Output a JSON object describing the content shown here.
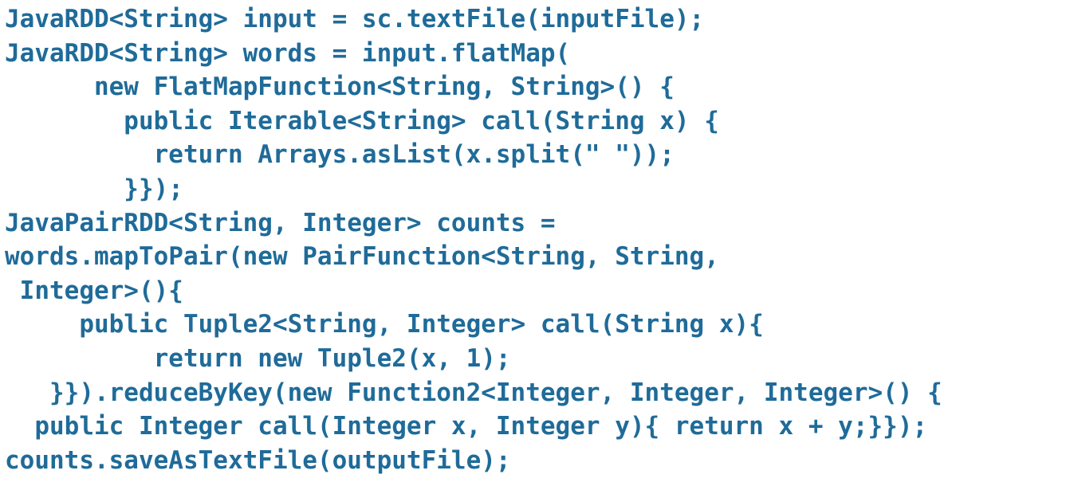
{
  "code": {
    "lines": [
      "JavaRDD<String> input = sc.textFile(inputFile);",
      "JavaRDD<String> words = input.flatMap(",
      "      new FlatMapFunction<String, String>() {",
      "        public Iterable<String> call(String x) {",
      "          return Arrays.asList(x.split(\" \"));",
      "        }});",
      "JavaPairRDD<String, Integer> counts =",
      "words.mapToPair(new PairFunction<String, String,",
      " Integer>(){",
      "     public Tuple2<String, Integer> call(String x){",
      "          return new Tuple2(x, 1);",
      "   }}).reduceByKey(new Function2<Integer, Integer, Integer>() {",
      "  public Integer call(Integer x, Integer y){ return x + y;}});",
      "counts.saveAsTextFile(outputFile);"
    ],
    "text_color": "#1f6b99",
    "background": "#ffffff"
  }
}
